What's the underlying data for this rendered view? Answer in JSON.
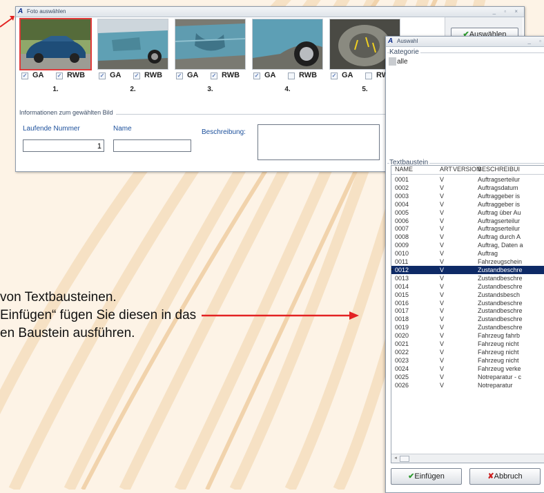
{
  "colors": {
    "accent_red": "#e32222",
    "selection_navy": "#0e2a66",
    "label_blue": "#1b4f9b",
    "background": "#fdf3e6"
  },
  "foto_window": {
    "title": "Foto auswählen",
    "controls": "_ ▫ ×",
    "select_button": "Auswählen",
    "thumbnails": [
      {
        "number": "1.",
        "ga_label": "GA",
        "ga_checked": true,
        "rwb_label": "RWB",
        "rwb_checked": true,
        "selected": true
      },
      {
        "number": "2.",
        "ga_label": "GA",
        "ga_checked": true,
        "rwb_label": "RWB",
        "rwb_checked": true
      },
      {
        "number": "3.",
        "ga_label": "GA",
        "ga_checked": true,
        "rwb_label": "RWB",
        "rwb_checked": true
      },
      {
        "number": "4.",
        "ga_label": "GA",
        "ga_checked": true,
        "rwb_label": "RWB",
        "rwb_checked": false
      },
      {
        "number": "5.",
        "ga_label": "GA",
        "ga_checked": true,
        "rwb_label": "RW",
        "rwb_checked": false
      }
    ],
    "info": {
      "group_title": "Informationen zum gewählten Bild",
      "laufende_nummer_label": "Laufende Nummer",
      "laufende_nummer_value": "1",
      "name_label": "Name",
      "name_value": "",
      "beschreibung_label": "Beschreibung:"
    }
  },
  "auswahl_window": {
    "title": "Auswahl",
    "controls": "_ ▫",
    "kategorie_title": "Kategorie",
    "kategorie_items": [
      "alle"
    ],
    "textbaustein_title": "Textbaustein",
    "columns": [
      "NAME",
      "ART",
      "VERSION",
      "BESCHREIBUI"
    ],
    "rows": [
      [
        "0001",
        "V",
        "Auftragserteilur"
      ],
      [
        "0002",
        "V",
        "Auftragsdatum"
      ],
      [
        "0003",
        "V",
        "Auftraggeber is"
      ],
      [
        "0004",
        "V",
        "Auftraggeber is"
      ],
      [
        "0005",
        "V",
        "Auftrag über Au"
      ],
      [
        "0006",
        "V",
        "Auftragserteilur"
      ],
      [
        "0007",
        "V",
        "Auftragserteilur"
      ],
      [
        "0008",
        "V",
        "Auftrag durch A"
      ],
      [
        "0009",
        "V",
        "Auftrag, Daten a"
      ],
      [
        "0010",
        "V",
        "Auftrag"
      ],
      [
        "0011",
        "V",
        "Fahrzeugschein"
      ],
      [
        "0012",
        "V",
        "Zustandbeschre"
      ],
      [
        "0013",
        "V",
        "Zustandbeschre"
      ],
      [
        "0014",
        "V",
        "Zustandbeschre"
      ],
      [
        "0015",
        "V",
        "Zustandsbesch"
      ],
      [
        "0016",
        "V",
        "Zustandbeschre"
      ],
      [
        "0017",
        "V",
        "Zustandbeschre"
      ],
      [
        "0018",
        "V",
        "Zustandbeschre"
      ],
      [
        "0019",
        "V",
        "Zustandbeschre"
      ],
      [
        "0020",
        "V",
        "Fahrzeug fahrb"
      ],
      [
        "0021",
        "V",
        "Fahrzeug nicht"
      ],
      [
        "0022",
        "V",
        "Fahrzeug nicht"
      ],
      [
        "0023",
        "V",
        "Fahrzeug nicht"
      ],
      [
        "0024",
        "V",
        "Fahrzeug verke"
      ],
      [
        "0025",
        "V",
        "Notreparatur - c"
      ],
      [
        "0026",
        "V",
        "Notreparatur"
      ]
    ],
    "selected_row": "0012",
    "insert_button": "Einfügen",
    "cancel_button": "Abbruch"
  },
  "slide_text": {
    "line1": "von Textbausteinen.",
    "line2": "Einfügen“  fügen Sie diesen in das",
    "line3": "en Baustein ausführen."
  }
}
